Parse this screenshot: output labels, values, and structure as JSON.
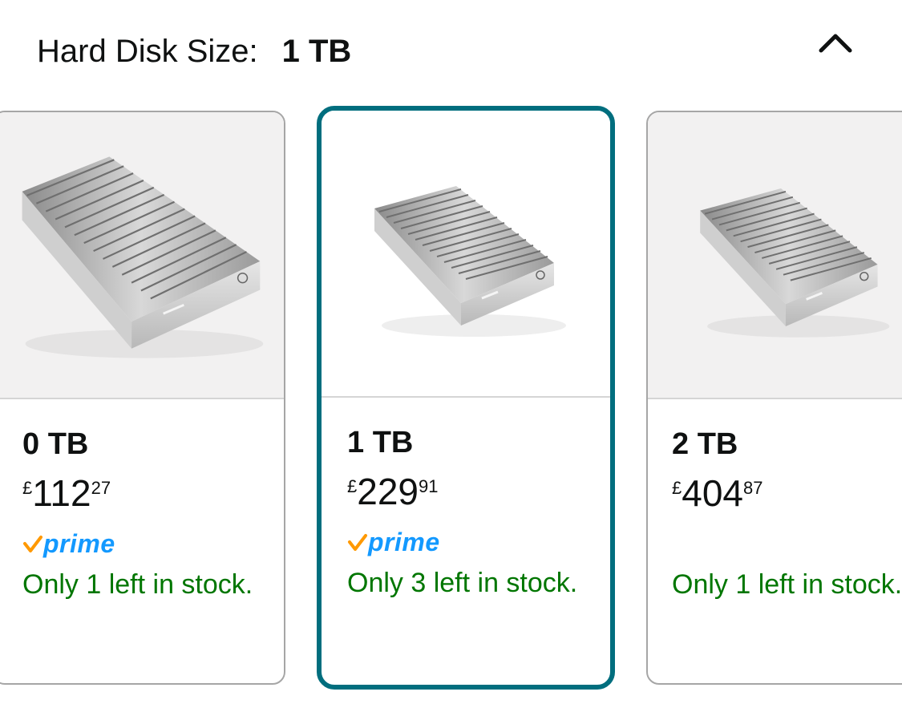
{
  "header": {
    "label": "Hard Disk Size:",
    "selected_value": "1 TB"
  },
  "icons": {
    "collapse": "chevron-up-icon",
    "prime_check": "check-icon",
    "product": "hard-drive-image"
  },
  "colors": {
    "selected_border": "#006e7e",
    "prime_blue": "#1399ff",
    "prime_check": "#ff9900",
    "stock_green": "#007600"
  },
  "options": [
    {
      "size": "0 TB",
      "currency": "£",
      "price_whole": "112",
      "price_fraction": "27",
      "prime": true,
      "prime_label": "prime",
      "stock": "Only 1 left in stock.",
      "selected": false
    },
    {
      "size": "1 TB",
      "currency": "£",
      "price_whole": "229",
      "price_fraction": "91",
      "prime": true,
      "prime_label": "prime",
      "stock": "Only 3 left in stock.",
      "selected": true
    },
    {
      "size": "2 TB",
      "currency": "£",
      "price_whole": "404",
      "price_fraction": "87",
      "prime": false,
      "stock": "Only 1 left in stock.",
      "selected": false
    }
  ]
}
